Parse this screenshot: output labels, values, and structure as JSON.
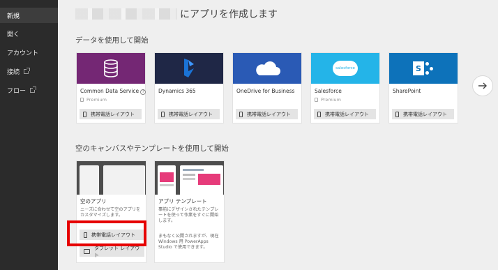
{
  "sidebar": {
    "items": [
      {
        "label": "新規",
        "active": true,
        "external": false
      },
      {
        "label": "開く",
        "active": false,
        "external": false
      },
      {
        "label": "アカウント",
        "active": false,
        "external": false
      },
      {
        "label": "接続",
        "active": false,
        "external": true
      },
      {
        "label": "フロー",
        "active": false,
        "external": true
      }
    ]
  },
  "header": {
    "title_suffix": "にアプリを作成します"
  },
  "section_data": {
    "title": "データを使用して開始",
    "cards": [
      {
        "name": "Common Data Service",
        "premium": "Premium",
        "button": "携帯電話レイアウト",
        "color": "#742774",
        "icon": "database-icon",
        "info": "?"
      },
      {
        "name": "Dynamics 365",
        "premium": "",
        "button": "携帯電話レイアウト",
        "color": "#1f2746",
        "icon": "dynamics-icon"
      },
      {
        "name": "OneDrive for Business",
        "premium": "",
        "button": "携帯電話レイアウト",
        "color": "#2a5ab5",
        "icon": "cloud-icon"
      },
      {
        "name": "Salesforce",
        "premium": "Premium",
        "button": "携帯電話レイアウト",
        "color": "#24b4e8",
        "icon": "salesforce-icon",
        "badge": "salesforce"
      },
      {
        "name": "SharePoint",
        "premium": "",
        "button": "携帯電話レイアウト",
        "color": "#0d72ba",
        "icon": "sharepoint-icon",
        "badge": "S"
      }
    ],
    "next": "next-arrow-icon"
  },
  "section_blank": {
    "title": "空のキャンバスやテンプレートを使用して開始",
    "blank_app": {
      "name": "空のアプリ",
      "desc": "ニーズに合わせて空のアプリをカスタマイズします。",
      "phone_button": "携帯電話レイアウト",
      "tablet_button": "タブレット レイアウト"
    },
    "template": {
      "name": "アプリ テンプレート",
      "desc": "事前にデザインされたテンプレートを使って作業をすぐに開始します。",
      "desc2": "まもなく公開されますが、現在 Windows 用 PowerApps Studio で使用できます。"
    }
  },
  "colors": {
    "highlight": "#e60000",
    "sidebar_bg": "#2b2b2b"
  }
}
